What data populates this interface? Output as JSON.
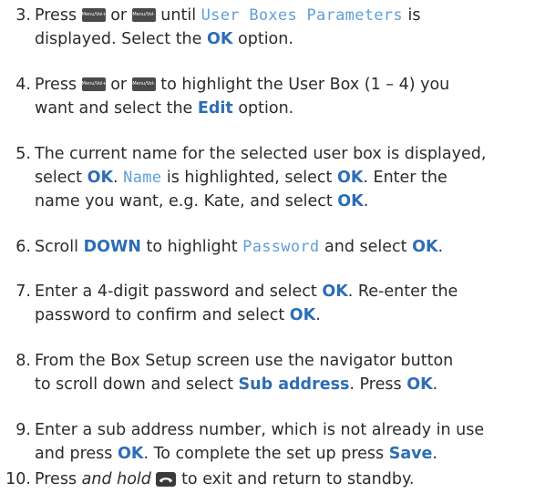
{
  "keys": {
    "menu_vol_plus": "Menu/Vol+",
    "menu_vol_minus": "Menu/Vol-"
  },
  "icons": {
    "end_key": "phone-end-key-icon"
  },
  "steps": {
    "s3": {
      "num": "3.",
      "t1": "Press",
      "t2": "or",
      "t3": "until",
      "lcd": "User Boxes Parameters",
      "t4": "is",
      "t5": "displayed. Select the",
      "b1": "OK",
      "t6": "option."
    },
    "s4": {
      "num": "4.",
      "t1": "Press",
      "t2": "or",
      "t3": "to highlight the User Box (1 – 4) you",
      "t4": "want and select the",
      "b1": "Edit",
      "t5": "option."
    },
    "s5": {
      "num": "5.",
      "t1": "The current name for the selected user box is displayed,",
      "t2": "select",
      "b1": "OK",
      "t3": ".",
      "lcd": "Name",
      "t4": "is highlighted, select",
      "b2": "OK",
      "t5": ". Enter the",
      "t6": "name you want, e.g. Kate, and select",
      "b3": "OK",
      "t7": "."
    },
    "s6": {
      "num": "6.",
      "t1": "Scroll",
      "b1": "DOWN",
      "t2": "to highlight",
      "lcd": "Password",
      "t3": "and select",
      "b2": "OK",
      "t4": "."
    },
    "s7": {
      "num": "7.",
      "t1": "Enter a 4-digit password and select",
      "b1": "OK",
      "t2": ". Re-enter the",
      "t3": "password to confirm and select",
      "b2": "OK",
      "t4": "."
    },
    "s8": {
      "num": "8.",
      "t1": "From the Box Setup screen use the navigator button",
      "t2": "to scroll down and select",
      "b1": "Sub address",
      "t3": ". Press",
      "b2": "OK",
      "t4": "."
    },
    "s9": {
      "num": "9.",
      "t1": "Enter a sub address number, which is not already in use",
      "t2": "and press",
      "b1": "OK",
      "t3": ". To complete the set up press",
      "b2": "Save",
      "t4": "."
    },
    "s10": {
      "num": "10.",
      "t1": "Press",
      "i1": "and hold",
      "t2": "to exit and return to standby."
    }
  }
}
